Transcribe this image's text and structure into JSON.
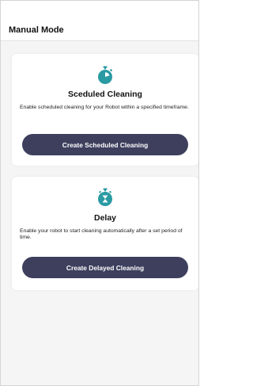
{
  "header": {
    "title": "Manual Mode"
  },
  "colors": {
    "accent_icon": "#2a9aa3",
    "button_bg": "#3d3f5d",
    "page_bg": "#f5f5f5"
  },
  "cards": [
    {
      "icon": "stopwatch-icon",
      "title": "Sceduled Cleaning",
      "description": "Enable scheduled cleaning for your Robot within a specified timeframe.",
      "button_label": "Create Scheduled Cleaning"
    },
    {
      "icon": "hourglass-timer-icon",
      "title": "Delay",
      "description": "Enable your robot to start cleaning automatically after a set period of time.",
      "button_label": "Create Delayed Cleaning"
    }
  ]
}
